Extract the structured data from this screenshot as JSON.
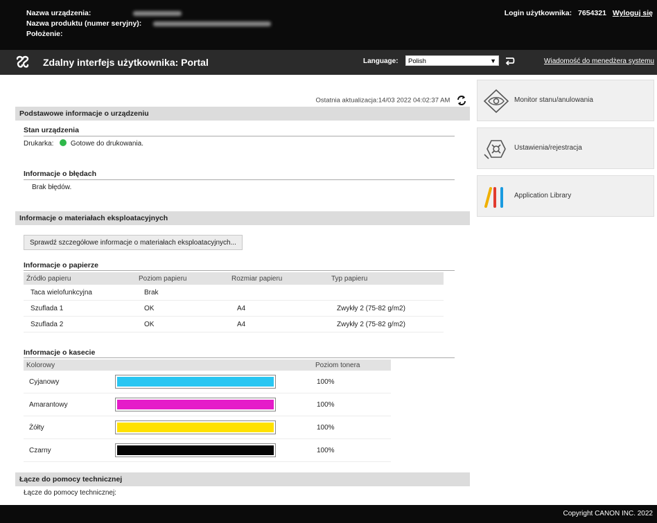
{
  "header": {
    "device_name_label": "Nazwa urządzenia:",
    "product_name_label": "Nazwa produktu (numer seryjny):",
    "location_label": "Położenie:",
    "login_label": "Login użytkownika:",
    "login_value": "7654321",
    "logout_link": "Wyloguj się"
  },
  "titlebar": {
    "title": "Zdalny interfejs użytkownika: Portal",
    "language_label": "Language:",
    "language_value": "Polish",
    "sysmgr_link": "Wiadomość do menedżera systemu"
  },
  "last_update": "Ostatnia aktualizacja:14/03 2022 04:02:37 AM",
  "device_info": {
    "section_title": "Podstawowe informacje o urządzeniu",
    "status_heading": "Stan urządzenia",
    "printer_label": "Drukarka:",
    "printer_status": "Gotowe do drukowania.",
    "status_color": "#2fb84a",
    "error_heading": "Informacje o błędach",
    "error_text": "Brak błędów."
  },
  "consumables": {
    "section_title": "Informacje o materiałach eksploatacyjnych",
    "details_button": "Sprawdź szczegółowe informacje o materiałach eksploatacyjnych...",
    "paper_heading": "Informacje o papierze",
    "paper_columns": [
      "Źródło papieru",
      "Poziom papieru",
      "Rozmiar papieru",
      "Typ papieru"
    ],
    "paper_rows": [
      [
        "Taca wielofunkcyjna",
        "Brak",
        "",
        ""
      ],
      [
        "Szuflada 1",
        "OK",
        "A4",
        "Zwykły 2 (75-82 g/m2)"
      ],
      [
        "Szuflada 2",
        "OK",
        "A4",
        "Zwykły 2 (75-82 g/m2)"
      ]
    ],
    "cartridge_heading": "Informacje o kasecie",
    "cartridge_columns": [
      "Kolorowy",
      "",
      "Poziom tonera"
    ],
    "cartridges": [
      {
        "name": "Cyjanowy",
        "level": "100%",
        "fill": 1.0,
        "color": "#29c6f2"
      },
      {
        "name": "Amarantowy",
        "level": "100%",
        "fill": 1.0,
        "color": "#e51cc9"
      },
      {
        "name": "Żółty",
        "level": "100%",
        "fill": 1.0,
        "color": "#ffe100"
      },
      {
        "name": "Czarny",
        "level": "100%",
        "fill": 1.0,
        "color": "#050505"
      }
    ]
  },
  "support": {
    "section_title": "Łącze do pomocy technicznej",
    "link_label": "Łącze do pomocy technicznej:"
  },
  "side_menu": {
    "items": [
      {
        "label": "Monitor stanu/anulowania",
        "icon": "monitor-eye-icon"
      },
      {
        "label": "Ustawienia/rejestracja",
        "icon": "settings-gear-icon"
      },
      {
        "label": "Application Library",
        "icon": "application-library-icon"
      }
    ]
  },
  "footer": {
    "copyright": "Copyright CANON INC. 2022"
  }
}
